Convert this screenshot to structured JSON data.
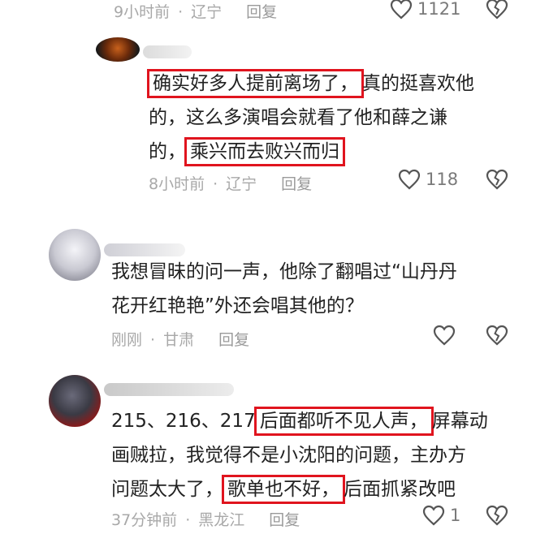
{
  "comment0": {
    "time": "9小时前",
    "location": "辽宁",
    "reply": "回复",
    "likes": "1121"
  },
  "comment1": {
    "lines": [
      {
        "hl": "确实好多人提前离场了，",
        "rest": "真的挺喜欢他"
      },
      {
        "pre": "的，这么多演唱会就看了他和薛之谦"
      },
      {
        "pre": "的，",
        "hl": "乘兴而去败兴而归"
      }
    ],
    "time": "8小时前",
    "location": "辽宁",
    "reply": "回复",
    "likes": "118"
  },
  "comment2": {
    "lines": [
      "我想冒昧的问一声，他除了翻唱过“山丹丹",
      "花开红艳艳”外还会唱其他的？"
    ],
    "time": "刚刚",
    "location": "甘肃",
    "reply": "回复"
  },
  "comment3": {
    "line1_pre": "215、216、217",
    "line1_hl": "后面都听不见人声，",
    "line1_rest": "屏幕动",
    "line2": "画贼拉，我觉得不是小沈阳的问题，主办方",
    "line3_pre": "问题太大了，",
    "line3_hl": "歌单也不好，",
    "line3_rest": "后面抓紧改吧",
    "time": "37分钟前",
    "location": "黑龙江",
    "reply": "回复",
    "likes": "1"
  },
  "icons": {
    "like": "heart-outline-icon",
    "dislike": "broken-heart-icon"
  },
  "colors": {
    "highlight_border": "#e0141e",
    "meta_text": "#a8a8a8",
    "icon_stroke": "#555555"
  }
}
